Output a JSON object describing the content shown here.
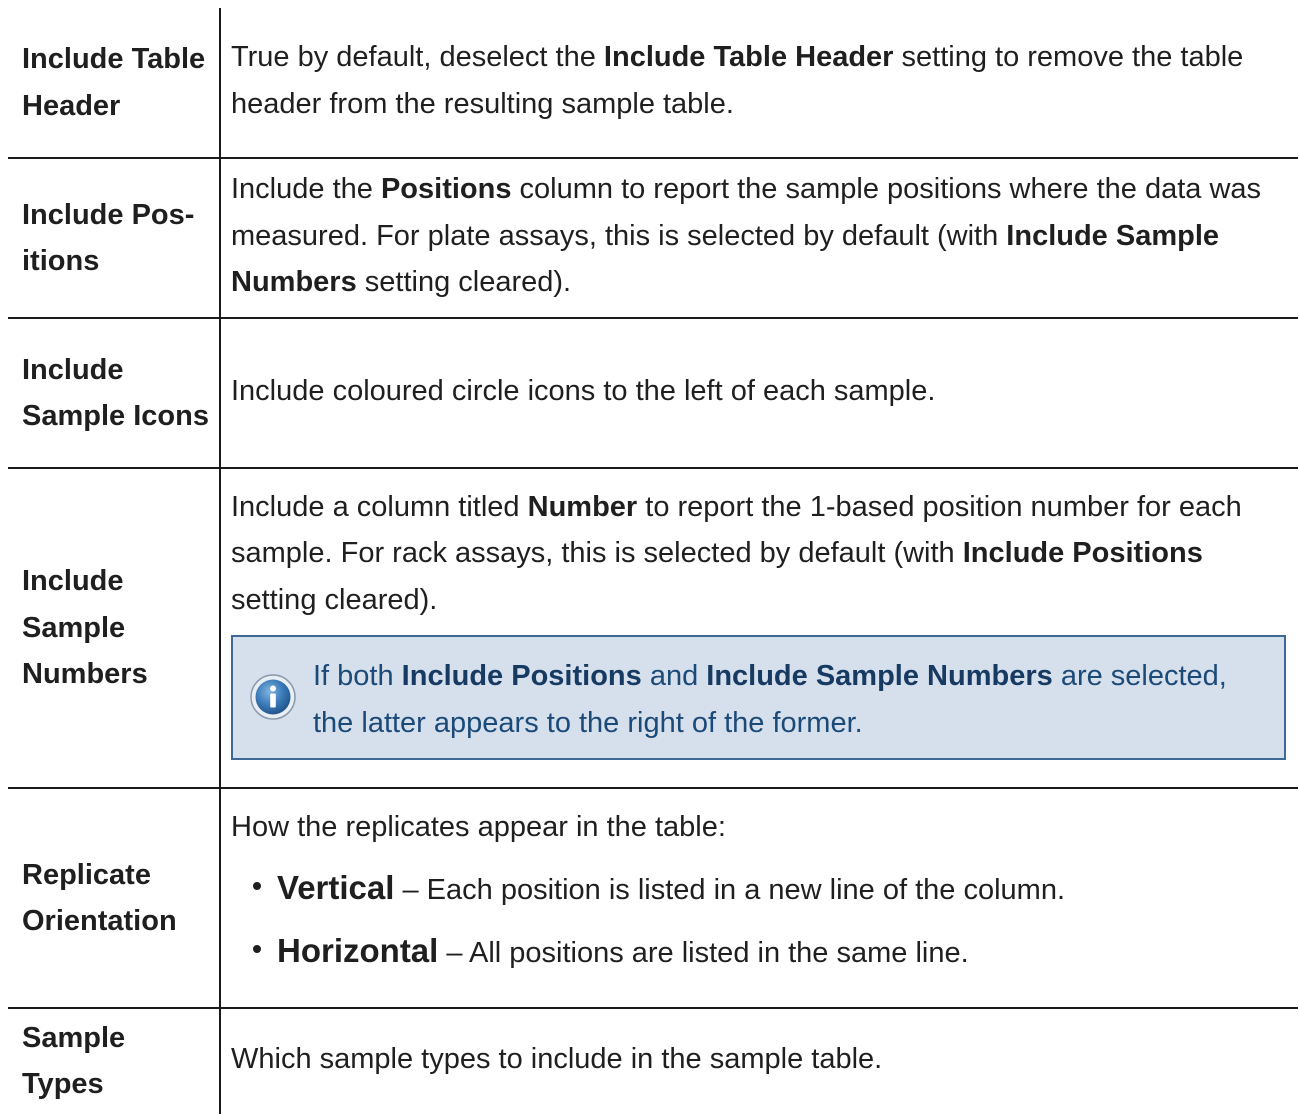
{
  "rows": [
    {
      "name": "Include Table Header",
      "desc": {
        "a": "True by default, deselect the ",
        "b": "Include Table Header",
        "c": " setting to remove the table header from the resulting sample table."
      }
    },
    {
      "name": "Include Pos- itions",
      "desc": {
        "a": "Include the ",
        "b": "Positions",
        "c": " column to report the sample positions where the data was measured. For plate assays, this is selected by default (with ",
        "d": "Include Sample Numbers",
        "e": " setting cleared)."
      }
    },
    {
      "name": "Include Sample Icons",
      "desc": {
        "a": "Include coloured circle icons to the left of each sample."
      }
    },
    {
      "name": "Include Sample Numbers",
      "desc": {
        "a": "Include a column titled ",
        "b": "Number",
        "c": " to report the 1-based position number for each sample. For rack assays, this is selected by default (with ",
        "d": "Include Positions",
        "e": " setting cleared)."
      },
      "note": {
        "icon": "info-icon",
        "a": "If both ",
        "b": "Include Positions",
        "c": " and ",
        "d": "Include Sample Numbers",
        "e": " are selected, the latter appears to the right of the former."
      }
    },
    {
      "name": "Replicate Orientation",
      "desc": {
        "a": "How the replicates appear in the table:"
      },
      "bullets": [
        {
          "term": "Vertical",
          "text": " – Each position is listed in a new line of the column."
        },
        {
          "term": "Horizontal",
          "text": " – All positions are listed in the same line."
        }
      ]
    },
    {
      "name": "Sample Types",
      "desc": {
        "a": "Which sample types to include in the sample table."
      }
    }
  ],
  "colors": {
    "note_background": "#d6e0ec",
    "note_border": "#3c6a94",
    "note_text": "#1c4a78",
    "text": "#1f1f1f",
    "border": "#1a1a1a"
  }
}
